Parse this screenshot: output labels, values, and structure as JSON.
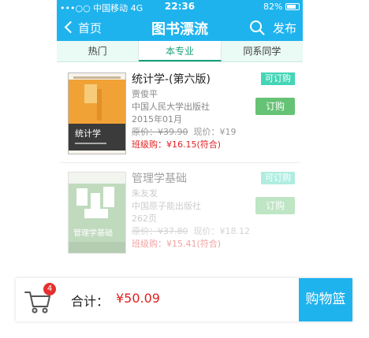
{
  "status": {
    "carrier": "•••○○ 中国移动  4G",
    "time": "22:36",
    "battery": "82%"
  },
  "header": {
    "back_label": "首页",
    "title": "图书漂流",
    "publish_label": "发布"
  },
  "tabs": [
    {
      "label": "热门",
      "active": false
    },
    {
      "label": "本专业",
      "active": true
    },
    {
      "label": "同系同学",
      "active": false
    }
  ],
  "books": [
    {
      "title": "统计学-(第六版)",
      "author": "贾俊平",
      "publisher": "中国人民大学出版社",
      "date": "2015年01月",
      "orig_price_label": "原价：",
      "orig_price": "¥39.90",
      "current_price_label": "现价：",
      "current_price": "¥19",
      "class_price": "班级购：¥16.15(符合)",
      "status": "可订购",
      "order_label": "订购",
      "cover_title": "统计学",
      "cover_accent": "#f1a237"
    },
    {
      "title": "管理学基础",
      "author": "朱友发",
      "publisher": "中国原子能出版社",
      "pages": "262页",
      "orig_price_label": "原价：",
      "orig_price": "¥37.80",
      "current_price_label": "现价：",
      "current_price": "¥18.12",
      "class_price": "班级购：¥15.41(符合)",
      "status": "可订购",
      "order_label": "订购",
      "cover_title": "管理学基础",
      "cover_accent": "#5f9c5a"
    }
  ],
  "cart": {
    "count": "4",
    "total_label": "合计：",
    "total_value": "¥50.09",
    "checkout_label": "购物篮"
  },
  "colors": {
    "primary": "#1fb3ee",
    "price_red": "#e02020",
    "order_green": "#66c275",
    "avail_teal": "#44d5b6"
  }
}
